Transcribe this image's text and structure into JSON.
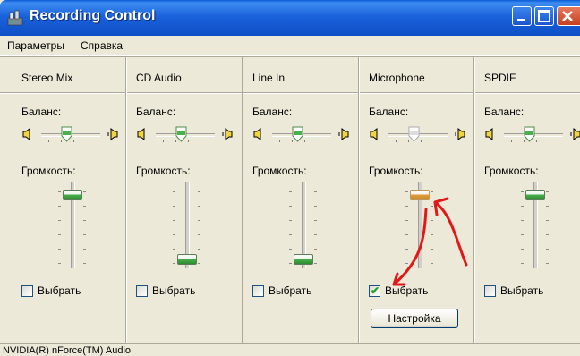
{
  "window": {
    "title": "Recording Control"
  },
  "menu": {
    "items": [
      "Параметры",
      "Справка"
    ]
  },
  "channels": [
    {
      "name": "Stereo Mix",
      "balance_label": "Баланс:",
      "volume_label": "Громкость:",
      "select_label": "Выбрать",
      "selected": false,
      "volume_level": 0.86
    },
    {
      "name": "CD Audio",
      "balance_label": "Баланс:",
      "volume_label": "Громкость:",
      "select_label": "Выбрать",
      "selected": false,
      "volume_level": 0.04
    },
    {
      "name": "Line In",
      "balance_label": "Баланс:",
      "volume_label": "Громкость:",
      "select_label": "Выбрать",
      "selected": false,
      "volume_level": 0.04
    },
    {
      "name": "Microphone",
      "balance_label": "Баланс:",
      "volume_label": "Громкость:",
      "select_label": "Выбрать",
      "selected": true,
      "volume_level": 0.86,
      "advanced_label": "Настройка"
    },
    {
      "name": "SPDIF",
      "balance_label": "Баланс:",
      "volume_label": "Громкость:",
      "select_label": "Выбрать",
      "selected": false,
      "volume_level": 0.86
    }
  ],
  "status": {
    "text": "NVIDIA(R) nForce(TM) Audio"
  },
  "colors": {
    "title_blue": "#0e4fc6",
    "annotation_red": "#e01818",
    "thumb_green": "#49b04a",
    "thumb_orange": "#e0a040"
  },
  "icons": {
    "app": "recording-control-icon",
    "speaker_left": "speaker-left-icon",
    "speaker_right": "speaker-right-icon"
  }
}
